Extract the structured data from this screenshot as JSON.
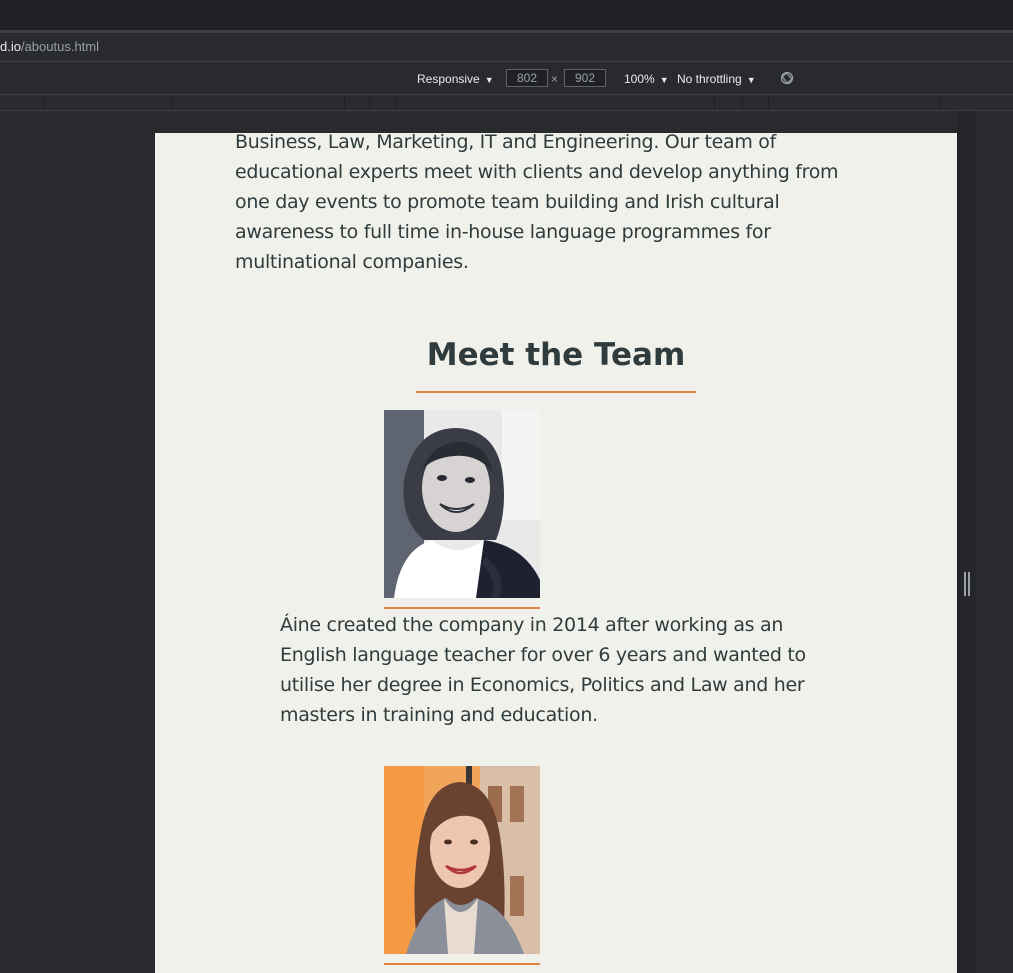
{
  "browser": {
    "url_host": "d.io",
    "url_path": "/aboutus.html"
  },
  "devtools": {
    "device": "Responsive",
    "width": "802",
    "height": "902",
    "times": "×",
    "zoom": "100%",
    "throttling": "No throttling"
  },
  "page": {
    "intro": "Business, Law, Marketing, IT and Engineering. Our team of educational experts meet with clients and develop anything from one day events to promote team building and Irish cultural awareness to full time in-house language programmes for multinational companies.",
    "heading": "Meet the Team",
    "team": [
      {
        "bio": "Áine created the company in 2014 after working as an English language teacher for over 6 years and wanted to utilise her degree in Economics, Politics and Law and her masters in training and education."
      },
      {
        "bio": ""
      }
    ]
  },
  "colors": {
    "accent": "#e8823e",
    "page_bg": "#f1f1ec",
    "text": "#2f3b3c",
    "chrome_bg": "#202124"
  }
}
